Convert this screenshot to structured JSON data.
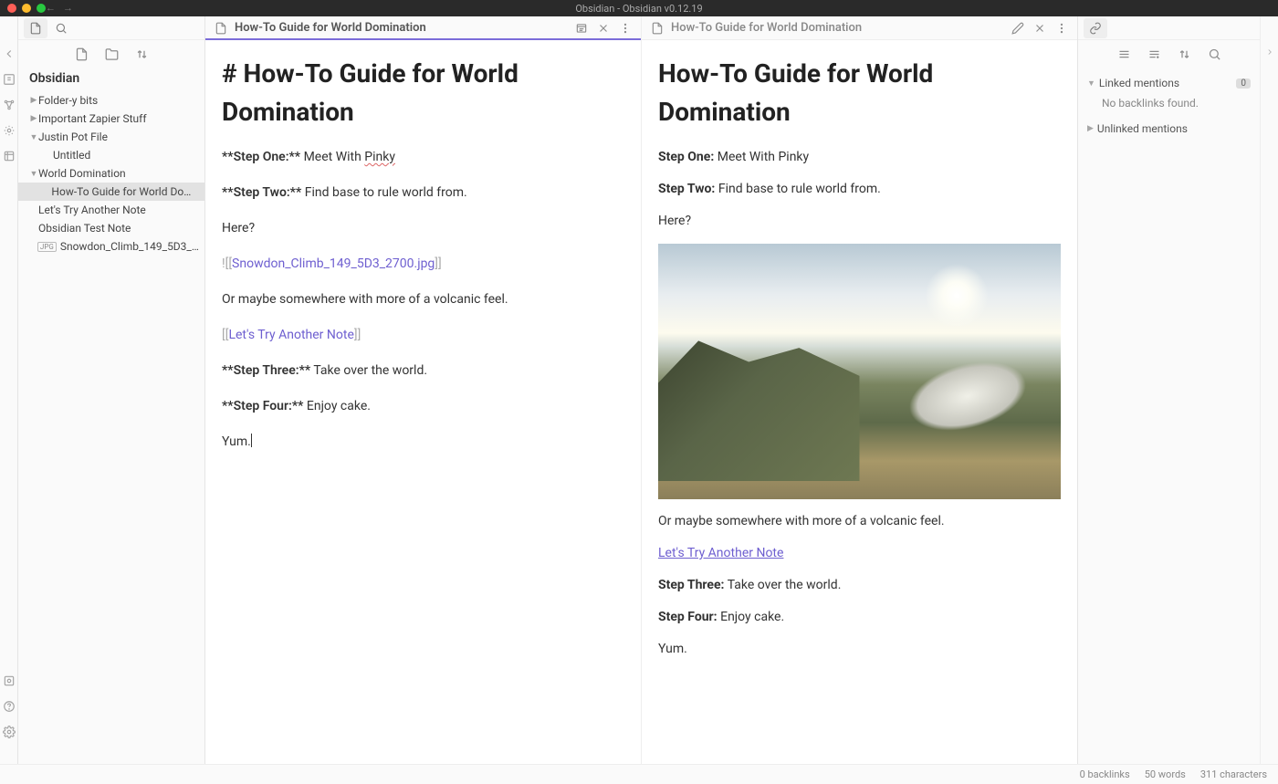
{
  "titlebar": {
    "title": "Obsidian - Obsidian v0.12.19"
  },
  "vault": {
    "name": "Obsidian"
  },
  "tree": [
    {
      "label": "Folder-y bits",
      "indent": 0,
      "caret": "▶",
      "type": "folder"
    },
    {
      "label": "Important Zapier Stuff",
      "indent": 0,
      "caret": "▶",
      "type": "folder"
    },
    {
      "label": "Justin Pot File",
      "indent": 0,
      "caret": "▼",
      "type": "folder"
    },
    {
      "label": "Untitled",
      "indent": 1,
      "caret": "",
      "type": "note"
    },
    {
      "label": "World Domination",
      "indent": 0,
      "caret": "▼",
      "type": "folder"
    },
    {
      "label": "How-To Guide for World Domination",
      "indent": 1,
      "caret": "",
      "type": "note",
      "active": true
    },
    {
      "label": "Let's Try Another Note",
      "indent": 0,
      "caret": "",
      "type": "note"
    },
    {
      "label": "Obsidian Test Note",
      "indent": 0,
      "caret": "",
      "type": "note"
    },
    {
      "label": "Snowdon_Climb_149_5D3_2700",
      "indent": 0,
      "caret": "",
      "type": "attachment",
      "badge": "JPG"
    }
  ],
  "editor": {
    "tab_title": "How-To Guide for World Domination",
    "heading": "# How-To Guide for World Domination",
    "lines": {
      "step1_bold": "**Step One:**",
      "step1_rest": " Meet With ",
      "step1_spell": "Pinky",
      "step2_bold": "**Step Two:**",
      "step2_rest": " Find base to rule world from.",
      "here": "Here?",
      "embed_prefix": "![[",
      "embed_file": "Snowdon_Climb_149_5D3_2700.jpg",
      "embed_suffix": "]]",
      "volcanic": "Or maybe somewhere with more of a volcanic feel.",
      "link_prefix": "[[",
      "link_target": "Let's Try Another Note",
      "link_suffix": "]]",
      "step3_bold": "**Step Three:**",
      "step3_rest": " Take over the world.",
      "step4_bold": "**Step Four:**",
      "step4_rest": " Enjoy cake.",
      "yum": "Yum."
    }
  },
  "preview": {
    "tab_title": "How-To Guide for World Domination",
    "heading": "How-To Guide for World Domination",
    "step1_label": "Step One:",
    "step1_text": " Meet With Pinky",
    "step2_label": "Step Two:",
    "step2_text": " Find base to rule world from.",
    "here": "Here?",
    "volcanic": "Or maybe somewhere with more of a volcanic feel.",
    "link_text": "Let's Try Another Note",
    "step3_label": "Step Three:",
    "step3_text": " Take over the world.",
    "step4_label": "Step Four:",
    "step4_text": " Enjoy cake.",
    "yum": "Yum."
  },
  "backlinks": {
    "linked_label": "Linked mentions",
    "linked_count": "0",
    "empty_text": "No backlinks found.",
    "unlinked_label": "Unlinked mentions"
  },
  "status": {
    "backlinks": "0 backlinks",
    "words": "50 words",
    "chars": "311 characters"
  }
}
